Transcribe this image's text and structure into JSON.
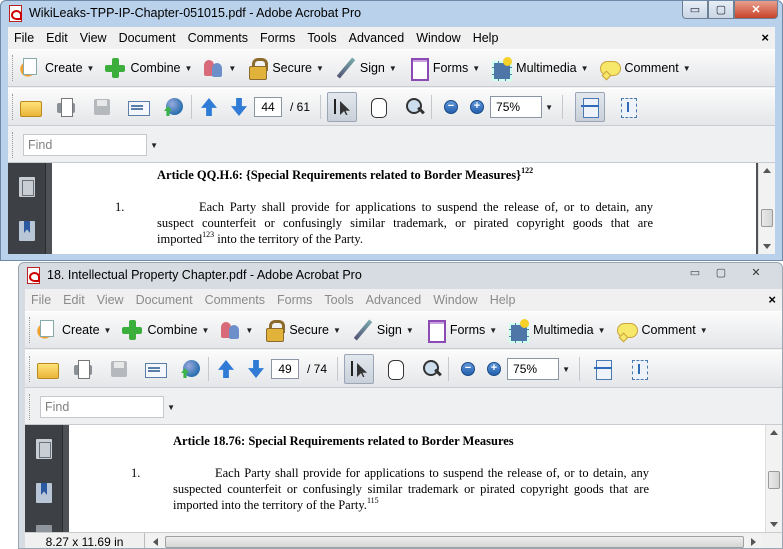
{
  "windows": [
    {
      "title": "WikiLeaks-TPP-IP-Chapter-051015.pdf - Adobe Acrobat Pro",
      "menu": [
        "File",
        "Edit",
        "View",
        "Document",
        "Comments",
        "Forms",
        "Tools",
        "Advanced",
        "Window",
        "Help"
      ],
      "tasks": {
        "create": "Create",
        "combine": "Combine",
        "secure": "Secure",
        "sign": "Sign",
        "forms": "Forms",
        "multimedia": "Multimedia",
        "comment": "Comment"
      },
      "page_current": "44",
      "page_total": "/ 61",
      "zoom": "75%",
      "find_placeholder": "Find",
      "article_heading": "Article QQ.H.6: {Special Requirements related to Border Measures}",
      "article_footnote": "122",
      "para_num": "1.",
      "para_text_a": "Each Party shall provide for applications to suspend the release of, or to detain, any suspect counterfeit or confusingly similar trademark, or pirated copyright goods that are imported",
      "para_footnote": "123",
      "para_text_b": " into the territory of the Party."
    },
    {
      "title": "18. Intellectual Property Chapter.pdf - Adobe Acrobat Pro",
      "menu": [
        "File",
        "Edit",
        "View",
        "Document",
        "Comments",
        "Forms",
        "Tools",
        "Advanced",
        "Window",
        "Help"
      ],
      "tasks": {
        "create": "Create",
        "combine": "Combine",
        "secure": "Secure",
        "sign": "Sign",
        "forms": "Forms",
        "multimedia": "Multimedia",
        "comment": "Comment"
      },
      "page_current": "49",
      "page_total": "/ 74",
      "zoom": "75%",
      "find_placeholder": "Find",
      "article_heading": "Article 18.76: Special Requirements related to Border Measures",
      "para_num": "1.",
      "para_text_a": "Each Party shall provide for applications to suspend the release of, or to detain, any suspected counterfeit or confusingly similar trademark or pirated copyright goods that are imported into the territory of the Party.",
      "para_footnote": "115",
      "page_size": "8.27 x 11.69 in"
    }
  ],
  "caption_buttons": {
    "minimize": "▭",
    "maximize": "▢",
    "close": "✕"
  },
  "menu_close": "×"
}
